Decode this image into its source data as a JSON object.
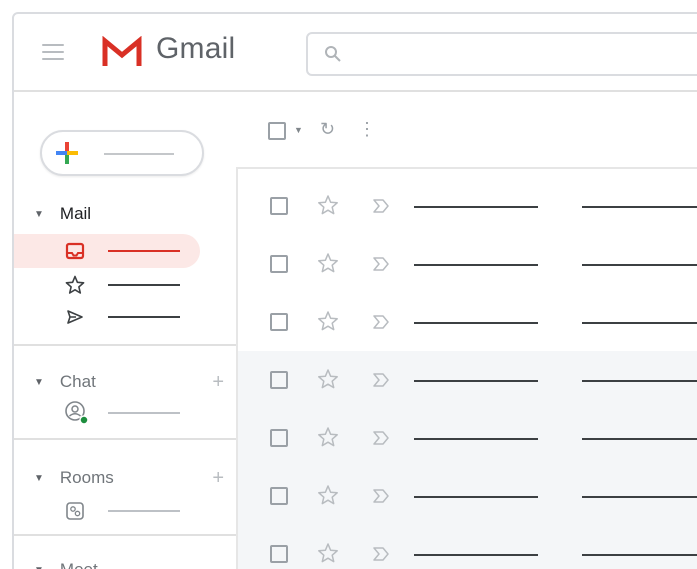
{
  "header": {
    "app_title": "Gmail",
    "menu_icon": "hamburger-menu-icon",
    "search_icon": "search-icon",
    "search_value": ""
  },
  "colors": {
    "accent": "#d93025",
    "active_bg": "#fce8e6",
    "row_shade": "#f4f6f8"
  },
  "sidebar": {
    "compose_icon": "plus-icon",
    "sections": {
      "mail": {
        "label": "Mail",
        "expanded": true
      },
      "chat": {
        "label": "Chat",
        "expanded": true,
        "add_label": "+"
      },
      "rooms": {
        "label": "Rooms",
        "expanded": true,
        "add_label": "+"
      },
      "meet": {
        "label": "Meet",
        "expanded": true
      }
    },
    "mail_items": [
      {
        "icon": "inbox-icon",
        "active": true
      },
      {
        "icon": "star-icon",
        "active": false
      },
      {
        "icon": "send-icon",
        "active": false
      }
    ],
    "chat_items": [
      {
        "icon": "user-status-icon"
      }
    ],
    "rooms_items": [
      {
        "icon": "room-icon"
      }
    ]
  },
  "toolbar": {
    "select_icon": "checkbox-icon",
    "dropdown_icon": "caret-down-icon",
    "refresh_icon": "refresh-icon",
    "more_icon": "more-vert-icon"
  },
  "message_list": {
    "row_icons": [
      "checkbox-icon",
      "star-icon",
      "important-icon"
    ],
    "rows": [
      {
        "shaded": false
      },
      {
        "shaded": false
      },
      {
        "shaded": false
      },
      {
        "shaded": true
      },
      {
        "shaded": true
      },
      {
        "shaded": true
      },
      {
        "shaded": true
      }
    ]
  }
}
